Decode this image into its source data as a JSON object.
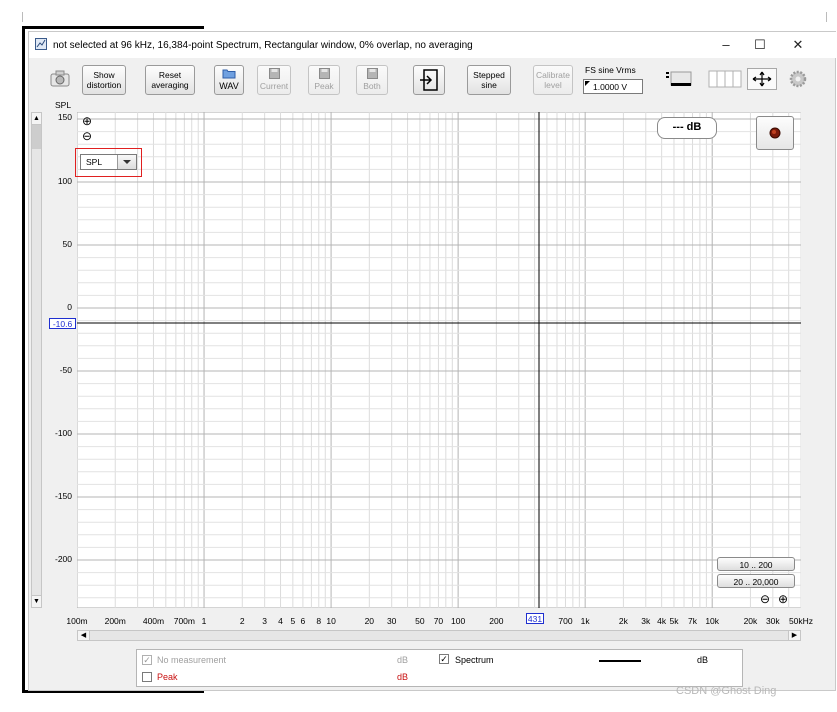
{
  "window": {
    "title": "not selected at 96 kHz, 16,384-point Spectrum, Rectangular window, 0% overlap, no averaging",
    "minimize": "–",
    "maximize": "☐",
    "close": "✕"
  },
  "toolbar": {
    "show_distortion": [
      "Show",
      "distortion"
    ],
    "reset_averaging": [
      "Reset",
      "averaging"
    ],
    "wav": "WAV",
    "current": "Current",
    "peak": "Peak",
    "both": "Both",
    "stepped_sine": [
      "Stepped",
      "sine"
    ],
    "calibrate_level": [
      "Calibrate",
      "level"
    ],
    "fs_sine_label": "FS sine Vrms",
    "fs_sine_value": "1.0000 V"
  },
  "plot": {
    "y_axis_title": "SPL",
    "y_ticks": [
      "150",
      "100",
      "50",
      "0",
      "-50",
      "-100",
      "-150",
      "-200"
    ],
    "y_cursor_value": "-10.6",
    "x_ticks": [
      "100m",
      "200m",
      "400m",
      "700m",
      "1",
      "2",
      "3",
      "4",
      "5",
      "6",
      "8",
      "10",
      "20",
      "30",
      "50",
      "70",
      "100",
      "200",
      "700",
      "1k",
      "2k",
      "3k",
      "4k",
      "5k",
      "7k",
      "10k",
      "20k",
      "30k",
      "50kHz"
    ],
    "x_cursor_value": "431",
    "spl_selector": "SPL",
    "level_readout": "--- dB",
    "range_btn_1": "10 .. 200",
    "range_btn_2": "20 .. 20,000",
    "zoom_in": "⊕",
    "zoom_out": "⊖"
  },
  "legend": {
    "row1_label": "No measurement",
    "row1_unit": "dB",
    "row1_checked": "✓",
    "row2_label": "Spectrum",
    "row2_unit": "dB",
    "row2_checked": "✓",
    "row3_label": "Peak",
    "row3_unit": "dB"
  },
  "watermark": "CSDN @Ghost Ding",
  "colors": {
    "accent_blue": "#1f2fd0",
    "peak_red": "#c81010",
    "highlight_red": "#e02020"
  }
}
